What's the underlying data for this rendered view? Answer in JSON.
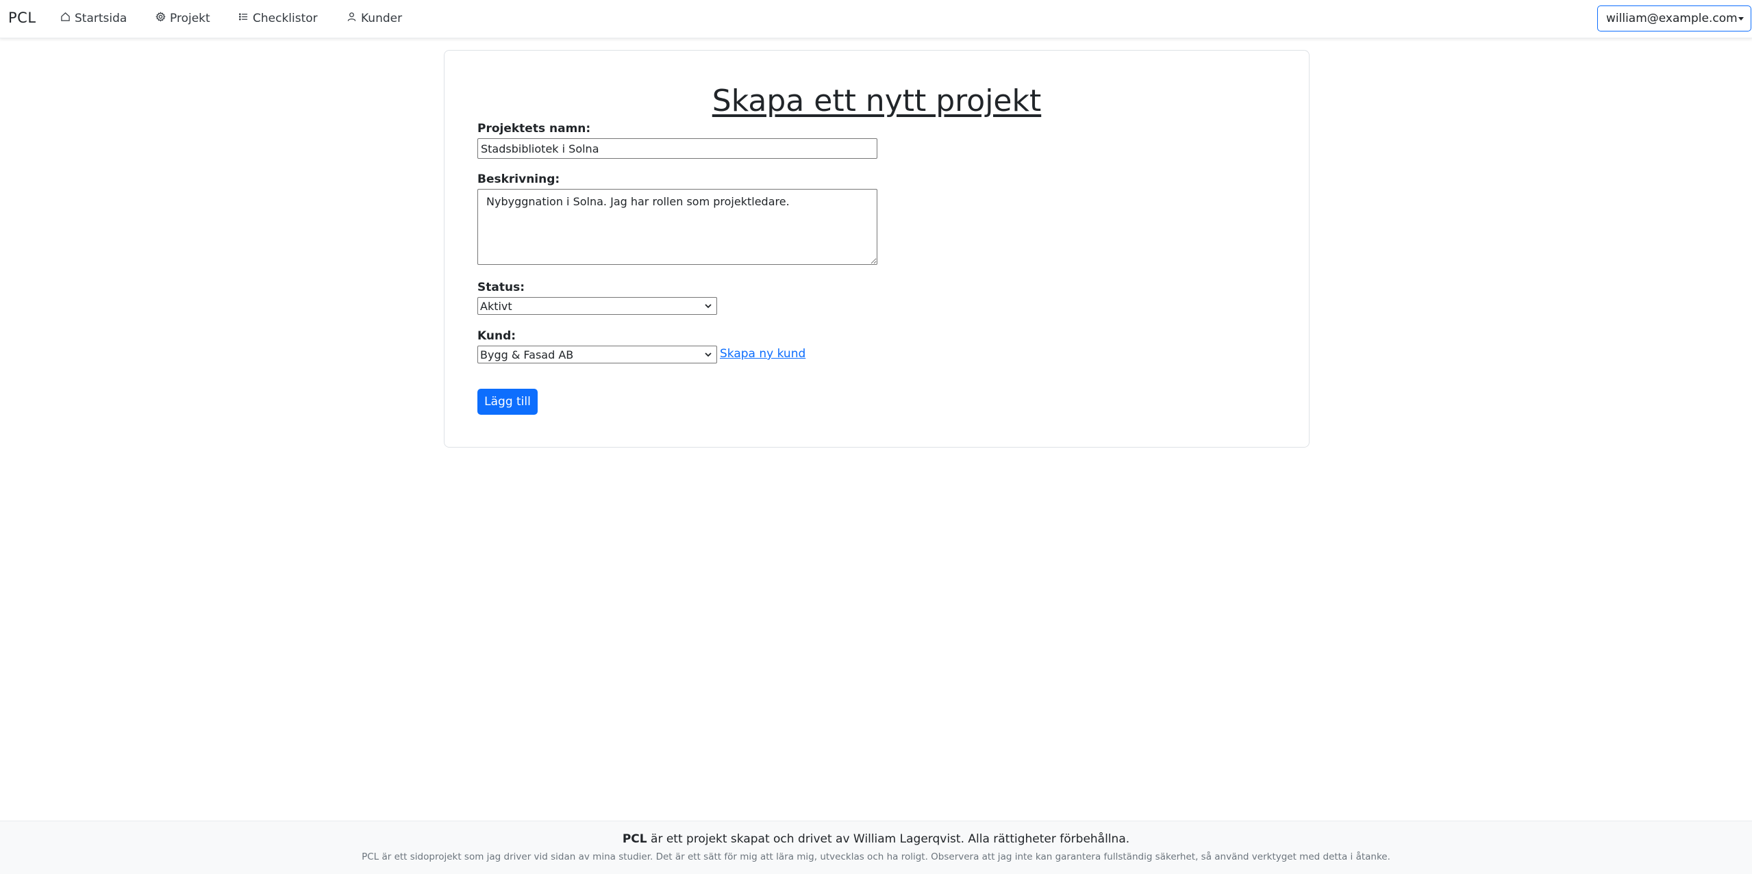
{
  "navbar": {
    "brand": "PCL",
    "items": [
      {
        "label": "Startsida",
        "icon": "house-icon"
      },
      {
        "label": "Projekt",
        "icon": "gear-icon"
      },
      {
        "label": "Checklistor",
        "icon": "list-icon"
      },
      {
        "label": "Kunder",
        "icon": "person-icon"
      }
    ],
    "user_email": "william@example.com"
  },
  "form": {
    "title": "Skapa ett nytt projekt",
    "name_label": "Projektets namn:",
    "name_value": "Stadsbibliotek i Solna",
    "description_label": "Beskrivning:",
    "description_value": "Nybyggnation i Solna. Jag har rollen som projektledare.",
    "status_label": "Status:",
    "status_value": "Aktivt",
    "customer_label": "Kund:",
    "customer_value": "Bygg & Fasad AB",
    "create_customer_link": "Skapa ny kund",
    "submit_label": "Lägg till"
  },
  "footer": {
    "brand": "PCL",
    "line1_rest": " är ett projekt skapat och drivet av William Lagerqvist. Alla rättigheter förbehållna.",
    "line2": "PCL är ett sidoprojekt som jag driver vid sidan av mina studier. Det är ett sätt för mig att lära mig, utvecklas och ha roligt. Observera att jag inte kan garantera fullständig säkerhet, så använd verktyget med detta i åtanke."
  },
  "colors": {
    "primary": "#0d6efd",
    "text": "#212529",
    "footer_bg": "#f8f9fa",
    "muted": "#6c757d"
  }
}
